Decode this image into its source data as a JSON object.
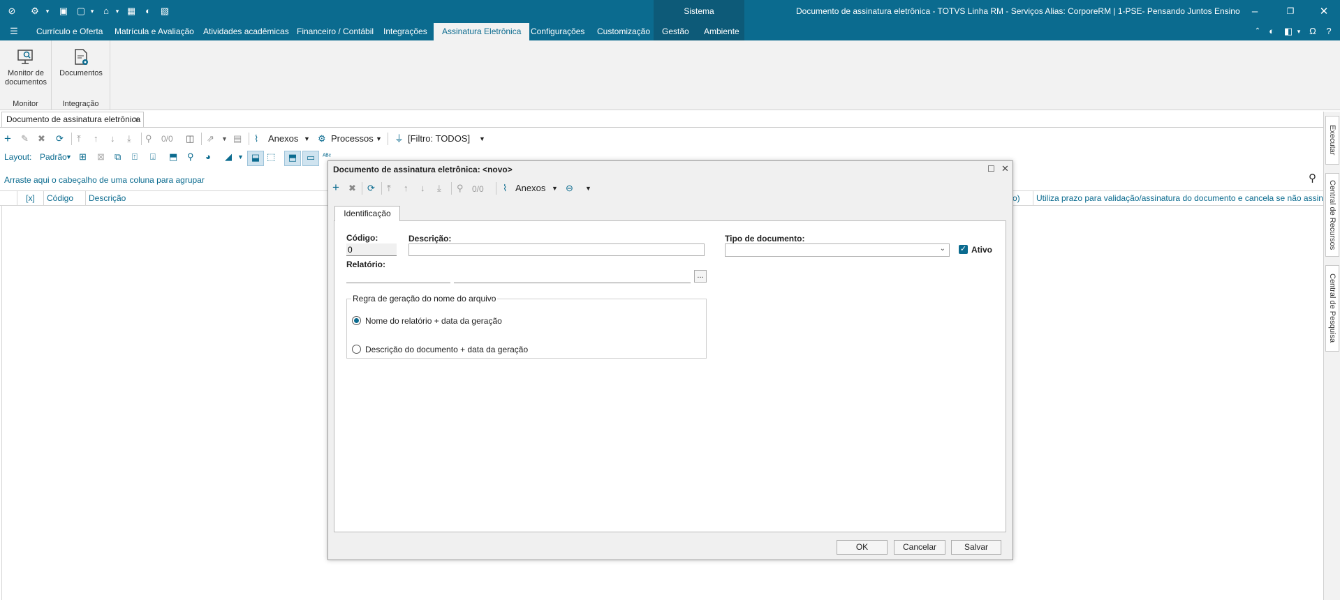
{
  "titlebar": {
    "system_label": "Sistema",
    "window_title": "Documento de assinatura eletrônica - TOTVS Linha RM - Serviços  Alias: CorporeRM | 1-PSE- Pensando Juntos Ensino"
  },
  "menu": {
    "items": [
      "Currículo e Oferta",
      "Matrícula e Avaliação",
      "Atividades acadêmicas",
      "Financeiro / Contábil",
      "Integrações",
      "Assinatura Eletrônica",
      "Configurações",
      "Customização",
      "Gestão",
      "Ambiente"
    ],
    "active": "Assinatura Eletrônica"
  },
  "ribbon": {
    "monitor_btn": "Monitor de documentos",
    "monitor_group": "Monitor",
    "docs_btn": "Documentos",
    "docs_group": "Integração"
  },
  "doc_tab": {
    "label": "Documento de assinatura eletrônica",
    "close": "×"
  },
  "toolbar": {
    "counter": "0/0",
    "anexos": "Anexos",
    "processos": "Processos",
    "filtro": "[Filtro: TODOS]",
    "layout_label": "Layout:",
    "layout_value": "Padrão"
  },
  "grid": {
    "group_hint": "Arraste aqui o cabeçalho de uma coluna para agrupar",
    "columns": [
      "[x]",
      "Código",
      "Descrição"
    ],
    "right_col_fragment": "o)",
    "right_col": "Utiliza prazo para validação/assinatura do documento e cancela se não assinado no pr"
  },
  "side_panel": {
    "tabs": [
      "Executar",
      "Central de Recursos",
      "Central de Pesquisa"
    ]
  },
  "dialog": {
    "title": "Documento de assinatura eletrônica: <novo>",
    "counter": "0/0",
    "anexos": "Anexos",
    "tab": "Identificação",
    "codigo_label": "Código:",
    "codigo_value": "0",
    "descricao_label": "Descrição:",
    "descricao_value": "",
    "tipo_label": "Tipo de documento:",
    "tipo_value": "",
    "ativo_label": "Ativo",
    "ativo_checked": true,
    "relatorio_label": "Relatório:",
    "relatorio_code": "",
    "relatorio_name": "",
    "browse": "...",
    "rule_legend": "Regra de geração do nome do arquivo",
    "rule_options": [
      "Nome do relatório + data da geração",
      "Descrição do documento + data da geração"
    ],
    "rule_selected": 0,
    "ok": "OK",
    "cancel": "Cancelar",
    "save": "Salvar"
  },
  "colors": {
    "brand": "#0b6b8f",
    "menu_sys": "#0d5a78",
    "accent_green": "#1a9d4b"
  }
}
